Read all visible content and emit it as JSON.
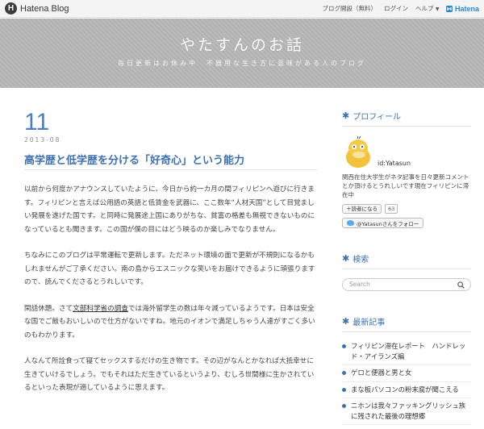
{
  "topbar": {
    "brand_name": "Hatena Blog",
    "links": [
      "ブログ開設（無料）",
      "ログイン",
      "ヘルプ"
    ],
    "hatena_label": "Hatena"
  },
  "header": {
    "title": "やたすんのお話",
    "description": "毎日更新はお休み中　不器用な生き方に意味がある人のブログ"
  },
  "entry": {
    "day": "11",
    "year_month": "2013-08",
    "title": "高学歴と低学歴を分ける「好奇心」という能力",
    "paragraphs": [
      "以前から何度かアナウンスしていたように、今日から約一カ月の間フィリピンへ遊びに行きます。フィリピンと言えば公用語の英語と低賃金を武器に、ここ数年“人材天国”として目覚ましい発展を遂げた国です。と同時に発展途上国にありがちな、貧富の格差も無視できないものになっているとも聞きます。この国が僕の目にはどう映るのか楽しみでなりません。",
      "ちなみにこのブログは平常運転で更新します。ただネット環境の面で更新が不規則になるかもしれませんがご了承ください。南の島からエスニックな笑いをお届けできるように頑張りますので、読んでくださるとうれしいです。",
      "閑話休題。さて",
      "文部科学省の調査",
      "では海外留学生の数は年々減っているようです。日本は安全な国でご飯もおいしいので仕方がないですね。地元のイオンで満足しちゃう人達がすごく多いのもわかります。",
      "人なんて所詮食って寝てセックスするだけの生き物です。その辺がなんとかなれば大抵幸せに生きていけるでしょう。でもそれはただ生きているというより、むしろ世間様に生かされているといった表現が適しているように思えます。"
    ]
  },
  "sidebar": {
    "profile": {
      "heading": "プロフィール",
      "id": "id:Yatasun",
      "text": "関西在住大学生がネタ記事を日々更新コメントとか頂けるとうれしいです現在フィリピンに滞在中",
      "reader_label": "読者になる",
      "reader_count": "63",
      "follow_label": "@Yatasunさんをフォロー"
    },
    "search": {
      "heading": "検索",
      "placeholder": "Search"
    },
    "recent": {
      "heading": "最新記事",
      "items": [
        "フィリピン滞在レポート　ハンドレッド・アイランズ編",
        "ゲロと便器と男と女",
        "まな板パソコンの粉末腐が聞こえる",
        "ニホンは我々ファッキングリッシュ族に残された最後の理想郷"
      ]
    }
  }
}
